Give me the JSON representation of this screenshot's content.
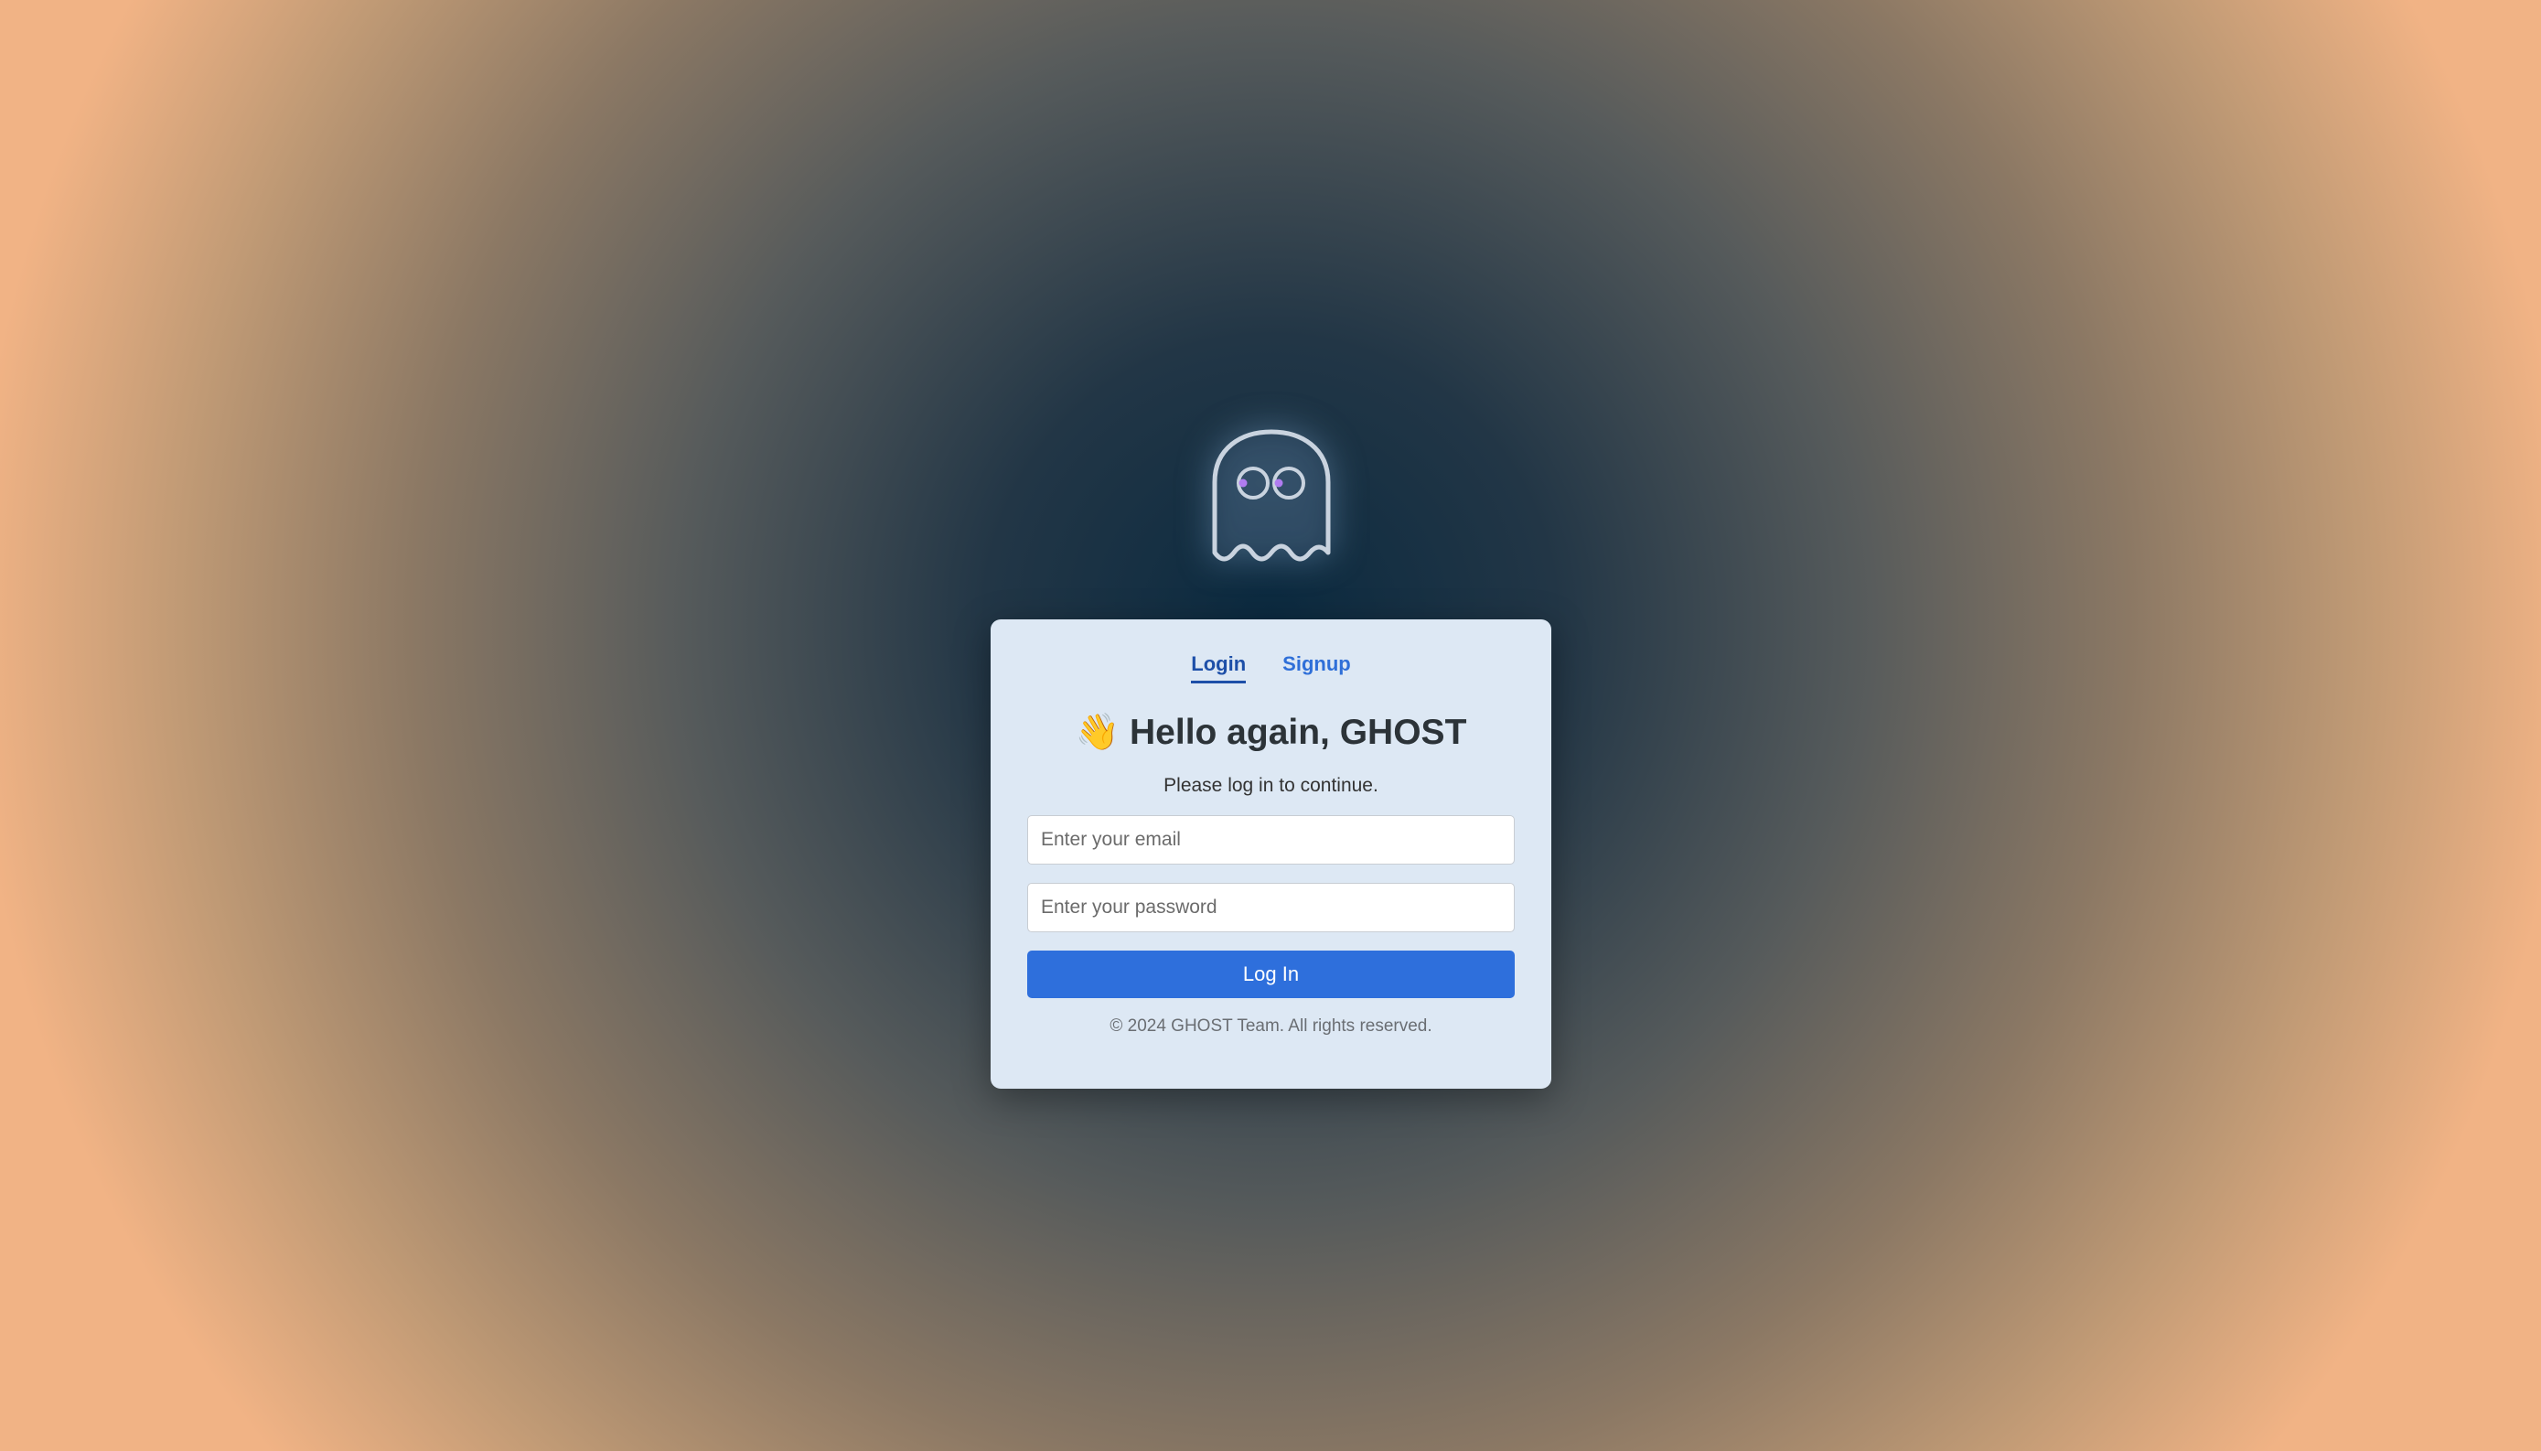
{
  "logo": {
    "icon": "ghost-icon",
    "glow_color": "#9ec3ea",
    "eye_color": "#b07cf0"
  },
  "auth": {
    "tabs": [
      {
        "label": "Login",
        "active": true
      },
      {
        "label": "Signup",
        "active": false
      }
    ],
    "heading_emoji": "👋",
    "heading": "Hello again, GHOST",
    "subtitle": "Please log in to continue.",
    "email_placeholder": "Enter your email",
    "password_placeholder": "Enter your password",
    "submit_label": "Log In",
    "footer": "© 2024 GHOST Team. All rights reserved."
  },
  "colors": {
    "accent": "#2e6fdc",
    "card_background": "#dde8f4",
    "background_center": "#0b2a40",
    "background_edge": "#f1b385"
  }
}
